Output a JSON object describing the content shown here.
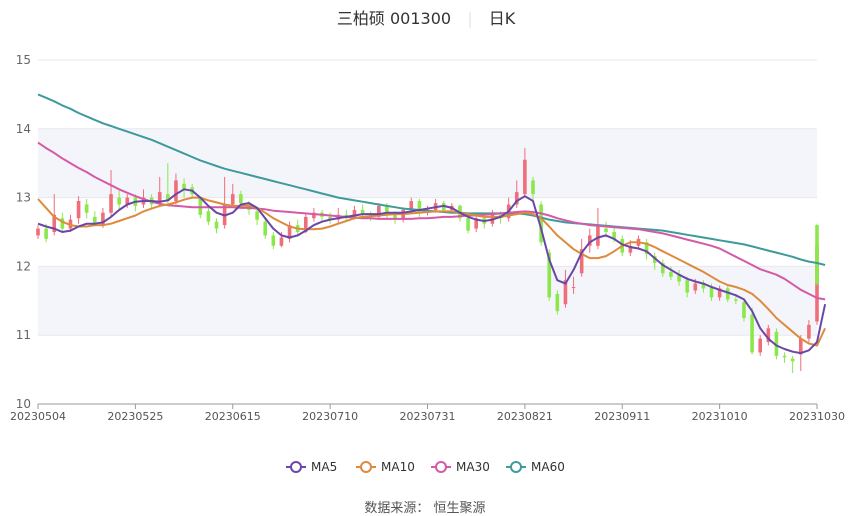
{
  "title": {
    "name": "三柏硕 001300",
    "period": "日K"
  },
  "source_text": "数据来源： 恒生聚源",
  "chart_data": {
    "type": "candlestick",
    "y_ticks": [
      "15",
      "14",
      "13",
      "12",
      "11",
      "10"
    ],
    "y_values": [
      15,
      14,
      13,
      12,
      11,
      10
    ],
    "ylim": [
      10,
      15
    ],
    "x_ticks": [
      "20230504",
      "20230525",
      "20230615",
      "20230710",
      "20230731",
      "20230821",
      "20230911",
      "20231010",
      "20231030"
    ],
    "x_tick_index": [
      0,
      12,
      24,
      36,
      48,
      60,
      72,
      84,
      96
    ],
    "num_days": 97,
    "colors": {
      "up": "#ee6e7a",
      "down": "#8ae84a",
      "MA5": "#6a46a8",
      "MA10": "#de8a3c",
      "MA30": "#d45aa8",
      "MA60": "#3f9a9c"
    },
    "candles": [
      [
        12.45,
        12.55,
        12.6,
        12.4
      ],
      [
        12.55,
        12.4,
        12.62,
        12.35
      ],
      [
        12.5,
        12.75,
        13.05,
        12.45
      ],
      [
        12.7,
        12.55,
        12.78,
        12.5
      ],
      [
        12.55,
        12.68,
        12.75,
        12.5
      ],
      [
        12.7,
        12.95,
        13.02,
        12.62
      ],
      [
        12.9,
        12.78,
        12.98,
        12.7
      ],
      [
        12.72,
        12.62,
        12.8,
        12.58
      ],
      [
        12.6,
        12.78,
        12.85,
        12.56
      ],
      [
        12.78,
        13.05,
        13.4,
        12.72
      ],
      [
        13.0,
        12.9,
        13.1,
        12.82
      ],
      [
        12.9,
        13.0,
        13.05,
        12.85
      ],
      [
        13.0,
        12.88,
        13.05,
        12.8
      ],
      [
        12.9,
        13.0,
        13.12,
        12.85
      ],
      [
        13.0,
        12.9,
        13.05,
        12.85
      ],
      [
        12.9,
        13.08,
        13.3,
        12.86
      ],
      [
        13.05,
        12.95,
        13.5,
        12.9
      ],
      [
        12.95,
        13.25,
        13.35,
        12.9
      ],
      [
        13.2,
        13.12,
        13.28,
        13.0
      ],
      [
        13.15,
        13.05,
        13.2,
        13.0
      ],
      [
        13.0,
        12.75,
        13.02,
        12.7
      ],
      [
        12.8,
        12.65,
        12.85,
        12.6
      ],
      [
        12.65,
        12.55,
        12.7,
        12.48
      ],
      [
        12.6,
        12.9,
        13.3,
        12.55
      ],
      [
        12.9,
        13.05,
        13.2,
        12.85
      ],
      [
        13.05,
        12.92,
        13.1,
        12.85
      ],
      [
        12.9,
        12.82,
        12.95,
        12.75
      ],
      [
        12.8,
        12.68,
        12.85,
        12.6
      ],
      [
        12.65,
        12.45,
        12.7,
        12.4
      ],
      [
        12.45,
        12.3,
        12.5,
        12.25
      ],
      [
        12.3,
        12.42,
        12.5,
        12.28
      ],
      [
        12.4,
        12.6,
        12.65,
        12.35
      ],
      [
        12.6,
        12.5,
        12.68,
        12.45
      ],
      [
        12.5,
        12.72,
        12.78,
        12.48
      ],
      [
        12.7,
        12.78,
        12.85,
        12.65
      ],
      [
        12.78,
        12.72,
        12.82,
        12.65
      ],
      [
        12.72,
        12.68,
        12.78,
        12.62
      ],
      [
        12.68,
        12.75,
        12.85,
        12.62
      ],
      [
        12.75,
        12.7,
        12.82,
        12.65
      ],
      [
        12.7,
        12.82,
        12.88,
        12.68
      ],
      [
        12.82,
        12.76,
        12.9,
        12.7
      ],
      [
        12.76,
        12.72,
        12.8,
        12.66
      ],
      [
        12.72,
        12.88,
        12.92,
        12.7
      ],
      [
        12.88,
        12.76,
        12.92,
        12.7
      ],
      [
        12.76,
        12.68,
        12.8,
        12.62
      ],
      [
        12.68,
        12.82,
        12.86,
        12.64
      ],
      [
        12.82,
        12.95,
        13.0,
        12.78
      ],
      [
        12.95,
        12.78,
        12.98,
        12.72
      ],
      [
        12.78,
        12.82,
        12.88,
        12.74
      ],
      [
        12.82,
        12.92,
        12.98,
        12.78
      ],
      [
        12.92,
        12.82,
        12.95,
        12.78
      ],
      [
        12.82,
        12.88,
        12.92,
        12.78
      ],
      [
        12.88,
        12.7,
        12.9,
        12.65
      ],
      [
        12.7,
        12.52,
        12.75,
        12.48
      ],
      [
        12.55,
        12.7,
        12.78,
        12.5
      ],
      [
        12.7,
        12.62,
        12.75,
        12.55
      ],
      [
        12.62,
        12.75,
        12.82,
        12.58
      ],
      [
        12.75,
        12.7,
        12.8,
        12.62
      ],
      [
        12.7,
        12.9,
        13.0,
        12.65
      ],
      [
        12.9,
        13.08,
        13.25,
        12.85
      ],
      [
        13.05,
        13.55,
        13.72,
        13.0
      ],
      [
        13.25,
        13.05,
        13.3,
        12.95
      ],
      [
        12.9,
        12.35,
        12.95,
        12.3
      ],
      [
        12.2,
        11.55,
        12.25,
        11.5
      ],
      [
        11.6,
        11.35,
        11.65,
        11.3
      ],
      [
        11.45,
        11.8,
        11.95,
        11.4
      ],
      [
        11.7,
        11.7,
        11.85,
        11.6
      ],
      [
        11.9,
        12.25,
        12.4,
        11.85
      ],
      [
        12.3,
        12.45,
        12.55,
        12.2
      ],
      [
        12.3,
        12.6,
        12.85,
        12.25
      ],
      [
        12.55,
        12.5,
        12.65,
        12.42
      ],
      [
        12.5,
        12.4,
        12.58,
        12.35
      ],
      [
        12.4,
        12.2,
        12.45,
        12.15
      ],
      [
        12.2,
        12.3,
        12.38,
        12.15
      ],
      [
        12.3,
        12.4,
        12.45,
        12.25
      ],
      [
        12.35,
        12.18,
        12.4,
        12.1
      ],
      [
        12.15,
        12.05,
        12.2,
        11.95
      ],
      [
        12.05,
        11.9,
        12.1,
        11.85
      ],
      [
        11.92,
        11.85,
        12.0,
        11.8
      ],
      [
        11.88,
        11.78,
        11.95,
        11.72
      ],
      [
        11.8,
        11.62,
        11.85,
        11.55
      ],
      [
        11.65,
        11.75,
        11.82,
        11.6
      ],
      [
        11.75,
        11.68,
        11.8,
        11.62
      ],
      [
        11.7,
        11.55,
        11.75,
        11.5
      ],
      [
        11.55,
        11.68,
        11.72,
        11.5
      ],
      [
        11.68,
        11.52,
        11.72,
        11.48
      ],
      [
        11.52,
        11.5,
        11.6,
        11.45
      ],
      [
        11.48,
        11.25,
        11.5,
        11.2
      ],
      [
        11.3,
        10.75,
        11.4,
        10.72
      ],
      [
        10.75,
        10.95,
        11.0,
        10.7
      ],
      [
        10.9,
        11.1,
        11.15,
        10.85
      ],
      [
        11.05,
        10.7,
        11.1,
        10.65
      ],
      [
        10.7,
        10.68,
        10.75,
        10.6
      ],
      [
        10.66,
        10.62,
        10.7,
        10.45
      ],
      [
        10.72,
        10.95,
        11.0,
        10.48
      ],
      [
        10.95,
        11.15,
        11.22,
        10.9
      ],
      [
        11.2,
        12.3,
        12.35,
        11.15
      ]
    ],
    "last_candle": [
      12.6,
      11.75,
      12.62,
      11.72
    ],
    "MA5": [
      12.62,
      12.58,
      12.55,
      12.5,
      12.52,
      12.58,
      12.62,
      12.62,
      12.64,
      12.72,
      12.82,
      12.9,
      12.94,
      12.95,
      12.95,
      12.94,
      12.96,
      13.05,
      13.12,
      13.1,
      13.0,
      12.88,
      12.78,
      12.74,
      12.78,
      12.9,
      12.92,
      12.85,
      12.7,
      12.55,
      12.45,
      12.42,
      12.45,
      12.52,
      12.6,
      12.65,
      12.68,
      12.7,
      12.72,
      12.74,
      12.76,
      12.76,
      12.76,
      12.78,
      12.78,
      12.78,
      12.8,
      12.82,
      12.84,
      12.86,
      12.88,
      12.85,
      12.78,
      12.72,
      12.68,
      12.66,
      12.68,
      12.72,
      12.8,
      12.95,
      13.02,
      12.95,
      12.55,
      12.1,
      11.8,
      11.75,
      11.95,
      12.2,
      12.35,
      12.42,
      12.45,
      12.4,
      12.32,
      12.28,
      12.26,
      12.22,
      12.12,
      12.02,
      11.95,
      11.88,
      11.82,
      11.78,
      11.75,
      11.7,
      11.66,
      11.62,
      11.58,
      11.52,
      11.35,
      11.1,
      10.95,
      10.85,
      10.8,
      10.76,
      10.74,
      10.78,
      10.9
    ],
    "MA5_last": 11.45,
    "MA10": [
      12.98,
      12.85,
      12.72,
      12.65,
      12.6,
      12.58,
      12.58,
      12.6,
      12.6,
      12.62,
      12.66,
      12.7,
      12.74,
      12.8,
      12.84,
      12.88,
      12.9,
      12.93,
      12.97,
      13.0,
      13.0,
      12.96,
      12.93,
      12.9,
      12.88,
      12.88,
      12.88,
      12.85,
      12.78,
      12.7,
      12.64,
      12.58,
      12.55,
      12.54,
      12.54,
      12.55,
      12.58,
      12.62,
      12.66,
      12.7,
      12.72,
      12.73,
      12.74,
      12.75,
      12.76,
      12.76,
      12.77,
      12.78,
      12.79,
      12.8,
      12.8,
      12.8,
      12.78,
      12.76,
      12.74,
      12.72,
      12.72,
      12.72,
      12.74,
      12.76,
      12.78,
      12.76,
      12.7,
      12.58,
      12.45,
      12.35,
      12.25,
      12.18,
      12.12,
      12.12,
      12.15,
      12.22,
      12.3,
      12.35,
      12.35,
      12.33,
      12.28,
      12.22,
      12.16,
      12.1,
      12.04,
      11.98,
      11.92,
      11.85,
      11.78,
      11.73,
      11.7,
      11.66,
      11.6,
      11.5,
      11.38,
      11.25,
      11.15,
      11.05,
      10.95,
      10.88,
      10.85
    ],
    "MA10_last": 11.1,
    "MA30": [
      13.8,
      13.72,
      13.65,
      13.57,
      13.5,
      13.43,
      13.37,
      13.3,
      13.24,
      13.18,
      13.12,
      13.07,
      13.02,
      12.98,
      12.94,
      12.91,
      12.89,
      12.88,
      12.87,
      12.86,
      12.86,
      12.86,
      12.86,
      12.86,
      12.86,
      12.85,
      12.85,
      12.84,
      12.83,
      12.81,
      12.8,
      12.79,
      12.78,
      12.77,
      12.76,
      12.75,
      12.74,
      12.73,
      12.72,
      12.71,
      12.7,
      12.7,
      12.69,
      12.69,
      12.69,
      12.69,
      12.69,
      12.7,
      12.7,
      12.71,
      12.72,
      12.72,
      12.73,
      12.74,
      12.74,
      12.75,
      12.76,
      12.77,
      12.78,
      12.79,
      12.8,
      12.79,
      12.77,
      12.74,
      12.7,
      12.67,
      12.64,
      12.62,
      12.6,
      12.59,
      12.58,
      12.57,
      12.56,
      12.55,
      12.54,
      12.52,
      12.5,
      12.48,
      12.45,
      12.42,
      12.39,
      12.36,
      12.33,
      12.3,
      12.26,
      12.2,
      12.14,
      12.08,
      12.02,
      11.96,
      11.92,
      11.88,
      11.82,
      11.74,
      11.66,
      11.6,
      11.54
    ],
    "MA30_last": 11.52,
    "MA60": [
      14.5,
      14.45,
      14.4,
      14.34,
      14.29,
      14.23,
      14.18,
      14.13,
      14.08,
      14.04,
      14.0,
      13.96,
      13.92,
      13.88,
      13.84,
      13.79,
      13.74,
      13.69,
      13.64,
      13.59,
      13.54,
      13.5,
      13.46,
      13.42,
      13.39,
      13.36,
      13.33,
      13.3,
      13.27,
      13.24,
      13.21,
      13.18,
      13.15,
      13.12,
      13.09,
      13.06,
      13.03,
      13.0,
      12.98,
      12.96,
      12.94,
      12.92,
      12.9,
      12.88,
      12.86,
      12.84,
      12.83,
      12.82,
      12.81,
      12.8,
      12.79,
      12.78,
      12.78,
      12.77,
      12.77,
      12.77,
      12.77,
      12.77,
      12.77,
      12.77,
      12.76,
      12.74,
      12.71,
      12.68,
      12.66,
      12.64,
      12.63,
      12.62,
      12.61,
      12.6,
      12.59,
      12.58,
      12.57,
      12.56,
      12.55,
      12.54,
      12.53,
      12.52,
      12.5,
      12.48,
      12.46,
      12.44,
      12.42,
      12.4,
      12.38,
      12.36,
      12.34,
      12.32,
      12.29,
      12.26,
      12.23,
      12.2,
      12.17,
      12.14,
      12.1,
      12.07,
      12.05
    ],
    "MA60_last": 12.02,
    "legend": [
      {
        "key": "MA5",
        "label": "MA5"
      },
      {
        "key": "MA10",
        "label": "MA10"
      },
      {
        "key": "MA30",
        "label": "MA30"
      },
      {
        "key": "MA60",
        "label": "MA60"
      }
    ],
    "grid": true,
    "legend_position": "bottom"
  }
}
